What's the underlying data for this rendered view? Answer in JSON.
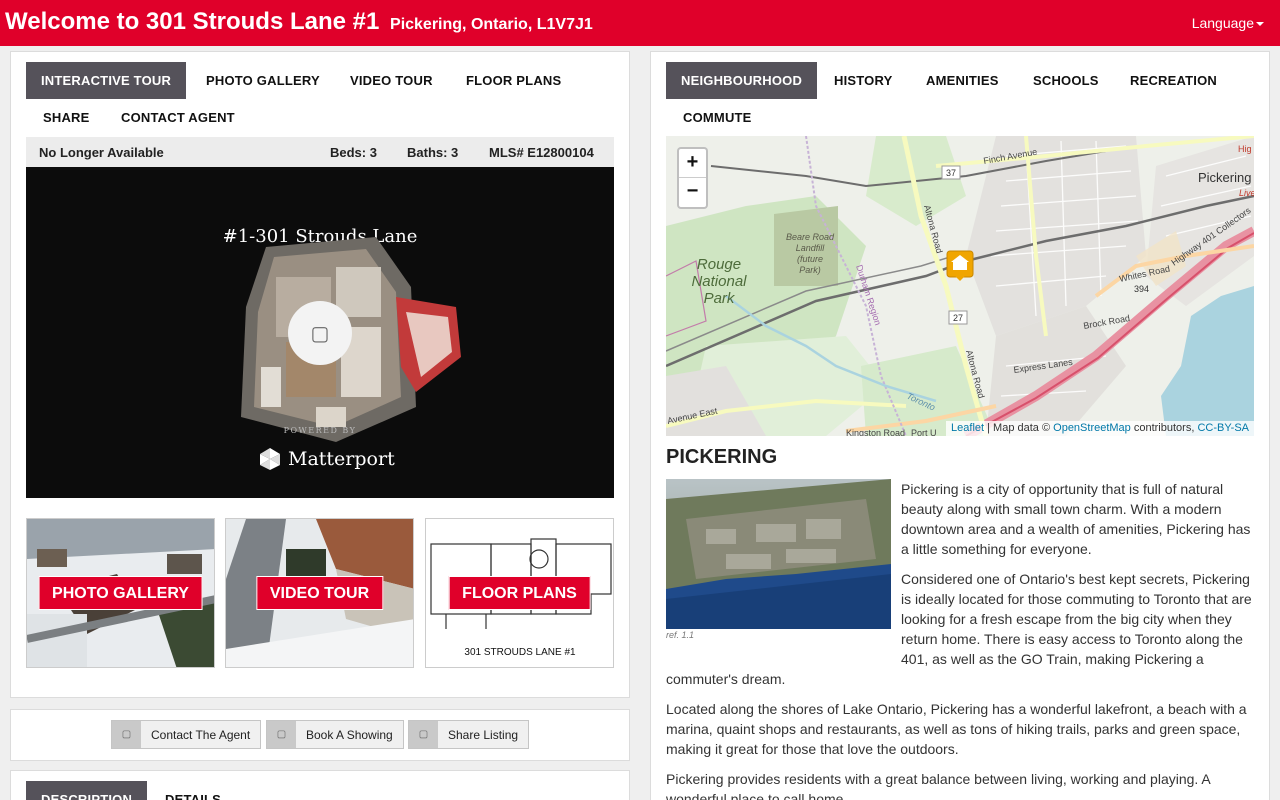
{
  "header": {
    "title": "Welcome to 301 Strouds Lane #1",
    "subtitle": "Pickering, Ontario, L1V7J1",
    "language_label": "Language"
  },
  "left_tabs": [
    "INTERACTIVE TOUR",
    "PHOTO GALLERY",
    "VIDEO TOUR",
    "FLOOR PLANS",
    "SHARE",
    "CONTACT AGENT"
  ],
  "listing": {
    "status": "No Longer Available",
    "beds": "Beds: 3",
    "baths": "Baths: 3",
    "mls": "MLS# E12800104"
  },
  "tour": {
    "name": "#1-301 Strouds Lane",
    "powered_by": "POWERED BY",
    "brand": "Matterport"
  },
  "thumbs": {
    "photo_gallery": "PHOTO GALLERY",
    "video_tour": "VIDEO TOUR",
    "floor_plans": "FLOOR PLANS",
    "floor_plan_caption": "301 STROUDS LANE #1"
  },
  "actions": [
    "Contact The Agent",
    "Book A Showing",
    "Share Listing"
  ],
  "bottom_tabs": [
    "DESCRIPTION",
    "DETAILS"
  ],
  "right_tabs": [
    "NEIGHBOURHOOD",
    "HISTORY",
    "AMENITIES",
    "SCHOOLS",
    "RECREATION",
    "COMMUTE"
  ],
  "map": {
    "zoom_in": "+",
    "zoom_out": "−",
    "labels": {
      "rouge_park": [
        "Rouge",
        "National",
        "Park"
      ],
      "beare_road": [
        "Beare Road",
        "Landfill",
        "(future",
        "Park)"
      ],
      "pickering": "Pickering",
      "pickering_live": "Live",
      "finch": "Finch Avenue",
      "altona": "Altona Road",
      "durham": "Durham Region",
      "whites": "Whites Road",
      "brock": "Brock Road",
      "express": "Express Lanes",
      "hwy401": "Highway 401 Collectors",
      "toronto": "Toronto",
      "kingston": "Kingston Road",
      "port_union": "Port U",
      "avenue_east": "Avenue East",
      "route_37": "37",
      "route_27": "27",
      "route_394": "394"
    },
    "attribution": {
      "leaflet": "Leaflet",
      "sep": " | Map data © ",
      "osm": "OpenStreetMap",
      "contrib": " contributors, ",
      "license": "CC-BY-SA"
    }
  },
  "neighbourhood": {
    "title": "PICKERING",
    "image_caption": "ref. 1.1",
    "p1": "Pickering is a city of opportunity that is full of natural beauty along with small town charm. With a modern downtown area and a wealth of amenities, Pickering has a little something for everyone.",
    "p2": "Considered one of Ontario's best kept secrets, Pickering is ideally located for those commuting to Toronto that are looking for a fresh escape from the big city when they return home. There is easy access to Toronto along the 401, as well as the GO Train, making Pickering a commuter's dream.",
    "p3": "Located along the shores of Lake Ontario, Pickering has a wonderful lakefront, a beach with a marina, quaint shops and restaurants, as well as tons of hiking trails, parks and green space, making it great for those that love the outdoors.",
    "p4": "Pickering provides residents with a great balance between living, working and playing. A wonderful place to call home."
  }
}
